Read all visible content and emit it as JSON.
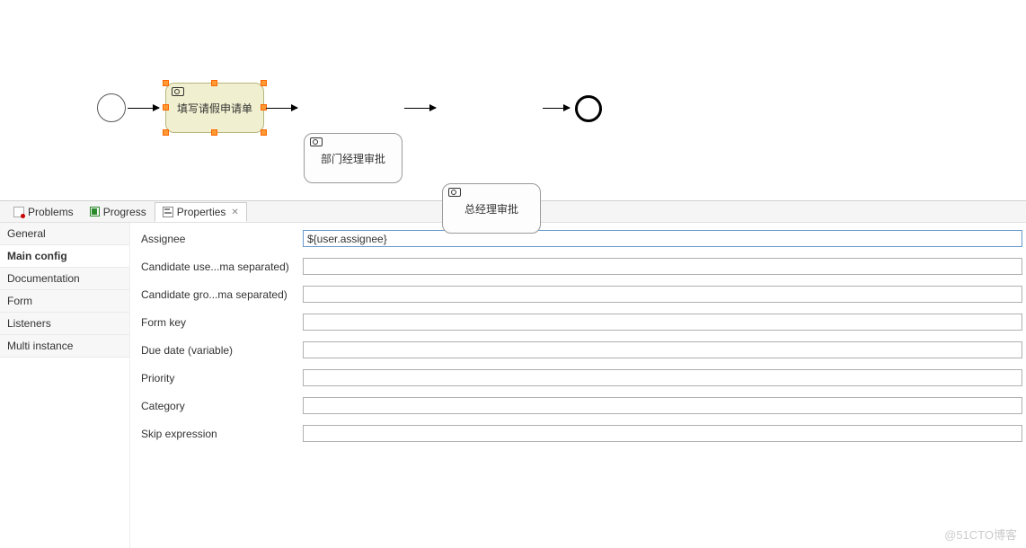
{
  "canvas": {
    "tasks": [
      {
        "label": "填写请假申请单",
        "selected": true
      },
      {
        "label": "部门经理审批",
        "selected": false
      },
      {
        "label": "总经理审批",
        "selected": false
      }
    ]
  },
  "tabs": {
    "problems": "Problems",
    "progress": "Progress",
    "properties": "Properties",
    "close_marker": "✕"
  },
  "sidebar": {
    "items": [
      {
        "label": "General"
      },
      {
        "label": "Main config"
      },
      {
        "label": "Documentation"
      },
      {
        "label": "Form"
      },
      {
        "label": "Listeners"
      },
      {
        "label": "Multi instance"
      }
    ],
    "active_index": 1
  },
  "form": {
    "fields": [
      {
        "label": "Assignee",
        "value": "${user.assignee}"
      },
      {
        "label": "Candidate use...ma separated)",
        "value": ""
      },
      {
        "label": "Candidate gro...ma separated)",
        "value": ""
      },
      {
        "label": "Form key",
        "value": ""
      },
      {
        "label": "Due date (variable)",
        "value": ""
      },
      {
        "label": "Priority",
        "value": ""
      },
      {
        "label": "Category",
        "value": ""
      },
      {
        "label": "Skip expression",
        "value": ""
      }
    ]
  },
  "watermark": "@51CTO博客"
}
